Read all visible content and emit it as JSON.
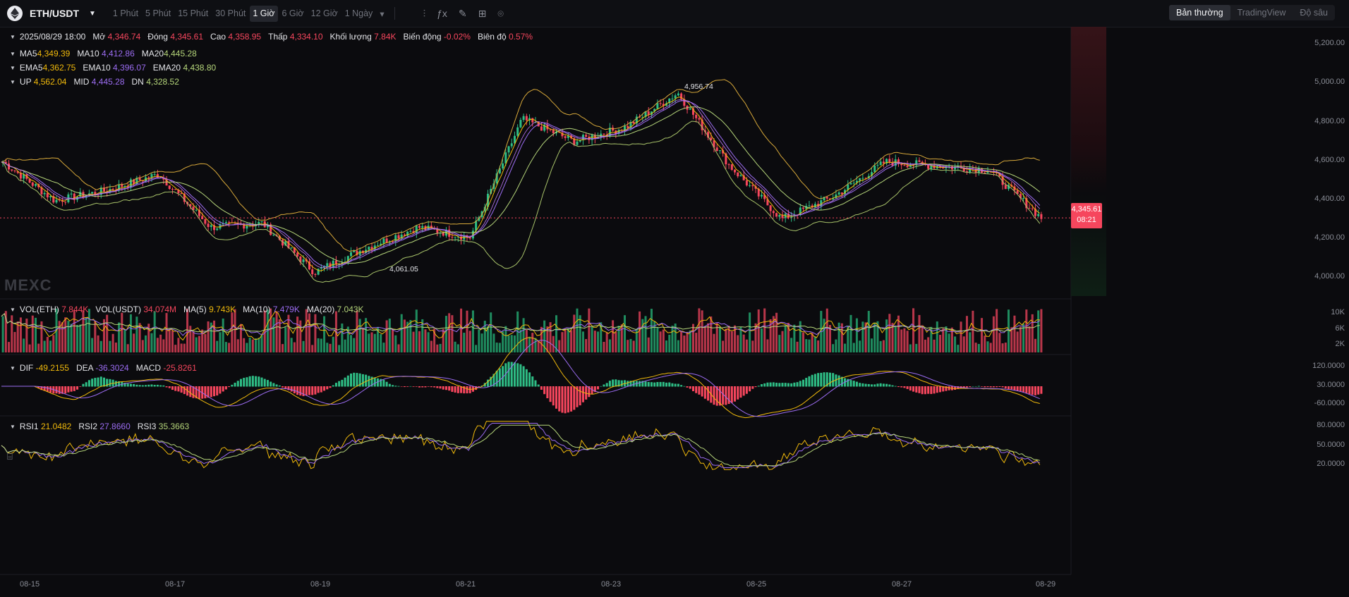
{
  "header": {
    "pair": "ETH/USDT",
    "intervals": [
      "1 Phút",
      "5 Phút",
      "15 Phút",
      "30 Phút",
      "1 Giờ",
      "6 Giờ",
      "12 Giờ",
      "1 Ngày"
    ],
    "active_interval": "1 Giờ",
    "views": [
      "Bản thường",
      "TradingView",
      "Độ sâu"
    ],
    "active_view": "Bản thường"
  },
  "ohlc": {
    "date": "2025/08/29 18:00",
    "open_label": "Mở",
    "open": "4,346.74",
    "close_label": "Đóng",
    "close": "4,345.61",
    "high_label": "Cao",
    "high": "4,358.95",
    "low_label": "Thấp",
    "low": "4,334.10",
    "volume_label": "Khối lượng",
    "volume": "7.84K",
    "change_label": "Biến động",
    "change": "-0.02%",
    "amp_label": "Biên độ",
    "amp": "0.57%"
  },
  "ma": {
    "ma5_label": "MA5",
    "ma5": "4,349.39",
    "ma10_label": "MA10",
    "ma10": "4,412.86",
    "ma20_label": "MA20",
    "ma20": "4,445.28"
  },
  "ema": {
    "ema5_label": "EMA5",
    "ema5": "4,362.75",
    "ema10_label": "EMA10",
    "ema10": "4,396.07",
    "ema20_label": "EMA20",
    "ema20": "4,438.80"
  },
  "boll": {
    "up_label": "UP",
    "up": "4,562.04",
    "mid_label": "MID",
    "mid": "4,445.28",
    "dn_label": "DN",
    "dn": "4,328.52"
  },
  "volume": {
    "eth_label": "VOL(ETH)",
    "eth": "7.844K",
    "usdt_label": "VOL(USDT)",
    "usdt": "34.074M",
    "ma5_label": "MA(5)",
    "ma5": "9.743K",
    "ma10_label": "MA(10)",
    "ma10": "7.479K",
    "ma20_label": "MA(20)",
    "ma20": "7.043K"
  },
  "macd": {
    "dif_label": "DIF",
    "dif": "-49.2155",
    "dea_label": "DEA",
    "dea": "-36.3024",
    "macd_label": "MACD",
    "macd": "-25.8261"
  },
  "rsi": {
    "rsi1_label": "RSI1",
    "rsi1": "21.0482",
    "rsi2_label": "RSI2",
    "rsi2": "27.8660",
    "rsi3_label": "RSI3",
    "rsi3": "35.3663"
  },
  "price_axis": [
    "5,200.00",
    "5,000.00",
    "4,800.00",
    "4,600.00",
    "4,400.00",
    "4,200.00",
    "4,000.00"
  ],
  "volume_axis": [
    "10K",
    "6K",
    "2K"
  ],
  "macd_axis": [
    "120.0000",
    "30.0000",
    "-60.0000"
  ],
  "rsi_axis": [
    "80.0000",
    "50.0000",
    "20.0000"
  ],
  "x_axis": [
    "08-15",
    "08-17",
    "08-19",
    "08-21",
    "08-23",
    "08-25",
    "08-27",
    "08-29"
  ],
  "current_price": "4,345.61",
  "countdown": "08:21",
  "high_mark": "4,956.74",
  "low_mark": "4,061.05",
  "watermark": "MEXC",
  "colors": {
    "up": "#2ebd85",
    "down": "#f6465d",
    "ma5": "#f0b90b",
    "ma10": "#9b6cf1",
    "ma20": "#b5d57a"
  },
  "chart_data": {
    "type": "line",
    "price_keypoints": [
      {
        "x": "08-15",
        "y": 4620
      },
      {
        "x": "08-16",
        "y": 4430
      },
      {
        "x": "08-17",
        "y": 4480
      },
      {
        "x": "08-17",
        "y": 4560
      },
      {
        "x": "08-18",
        "y": 4300
      },
      {
        "x": "08-19",
        "y": 4320
      },
      {
        "x": "08-20",
        "y": 4080
      },
      {
        "x": "08-20",
        "y": 4200
      },
      {
        "x": "08-21",
        "y": 4300
      },
      {
        "x": "08-22",
        "y": 4250
      },
      {
        "x": "08-22",
        "y": 4830
      },
      {
        "x": "08-23",
        "y": 4720
      },
      {
        "x": "08-24",
        "y": 4790
      },
      {
        "x": "08-24",
        "y": 4956.74
      },
      {
        "x": "08-25",
        "y": 4600
      },
      {
        "x": "08-25",
        "y": 4340
      },
      {
        "x": "08-26",
        "y": 4450
      },
      {
        "x": "08-26",
        "y": 4620
      },
      {
        "x": "08-27",
        "y": 4600
      },
      {
        "x": "08-28",
        "y": 4580
      },
      {
        "x": "08-29",
        "y": 4345.61
      }
    ],
    "ylim": [
      3950,
      5280
    ]
  }
}
